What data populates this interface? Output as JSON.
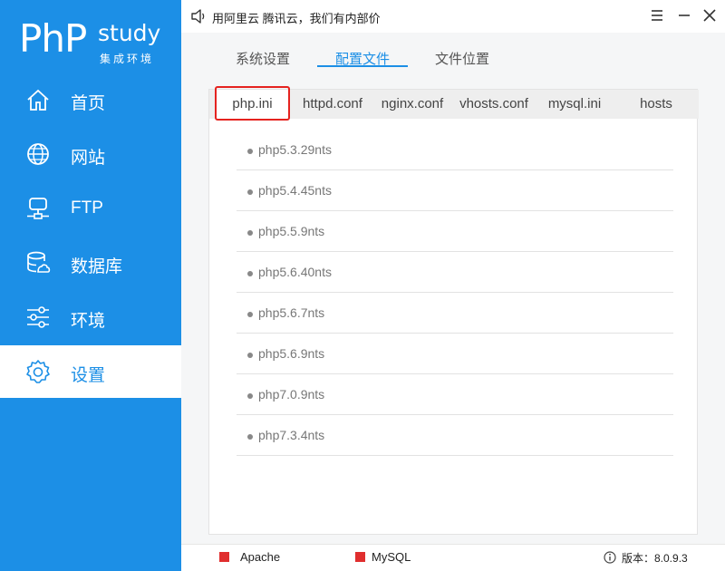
{
  "logo": {
    "php": "PhP",
    "study": "study",
    "subtitle": "集成环境"
  },
  "sidebar": {
    "items": [
      {
        "label": "首页",
        "icon": "home-icon"
      },
      {
        "label": "网站",
        "icon": "globe-icon"
      },
      {
        "label": "FTP",
        "icon": "ftp-server-icon"
      },
      {
        "label": "数据库",
        "icon": "database-icon"
      },
      {
        "label": "环境",
        "icon": "sliders-icon"
      },
      {
        "label": "设置",
        "icon": "gear-icon",
        "active": true
      }
    ]
  },
  "topbar": {
    "notice": "用阿里云 腾讯云，我们有内部价"
  },
  "main": {
    "tabs": [
      {
        "label": "系统设置"
      },
      {
        "label": "配置文件",
        "active": true
      },
      {
        "label": "文件位置"
      }
    ],
    "subtabs": [
      {
        "label": "php.ini",
        "active": true
      },
      {
        "label": "httpd.conf"
      },
      {
        "label": "nginx.conf"
      },
      {
        "label": "vhosts.conf"
      },
      {
        "label": "mysql.ini"
      },
      {
        "label": "hosts"
      }
    ],
    "versions": [
      "php5.3.29nts",
      "php5.4.45nts",
      "php5.5.9nts",
      "php5.6.40nts",
      "php5.6.7nts",
      "php5.6.9nts",
      "php7.0.9nts",
      "php7.3.4nts"
    ]
  },
  "statusbar": {
    "services": [
      {
        "name": "Apache",
        "status_color": "#e02e2e"
      },
      {
        "name": "MySQL",
        "status_color": "#e02e2e"
      }
    ],
    "version": "版本：8.0.9.3"
  },
  "colors": {
    "accent": "#1c8fe6",
    "highlight": "#e5231f"
  }
}
